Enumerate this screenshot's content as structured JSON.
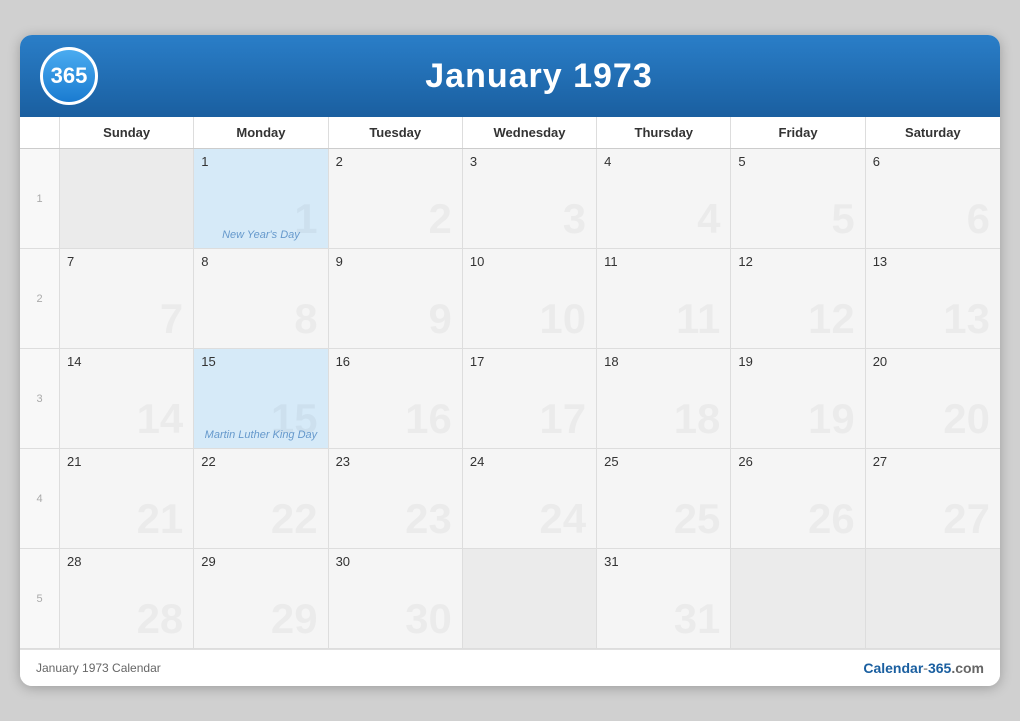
{
  "header": {
    "logo": "365",
    "title": "January 1973"
  },
  "days": [
    "Sunday",
    "Monday",
    "Tuesday",
    "Wednesday",
    "Thursday",
    "Friday",
    "Saturday"
  ],
  "weeks": [
    {
      "week_num": "1",
      "cells": [
        {
          "date": "",
          "empty": true
        },
        {
          "date": "1",
          "holiday": "New Year's Day",
          "highlight": true
        },
        {
          "date": "2"
        },
        {
          "date": "3"
        },
        {
          "date": "4"
        },
        {
          "date": "5"
        },
        {
          "date": "6"
        }
      ]
    },
    {
      "week_num": "2",
      "cells": [
        {
          "date": "7"
        },
        {
          "date": "8"
        },
        {
          "date": "9"
        },
        {
          "date": "10"
        },
        {
          "date": "11"
        },
        {
          "date": "12"
        },
        {
          "date": "13"
        }
      ]
    },
    {
      "week_num": "3",
      "cells": [
        {
          "date": "14"
        },
        {
          "date": "15",
          "holiday": "Martin Luther King Day",
          "highlight": true
        },
        {
          "date": "16"
        },
        {
          "date": "17"
        },
        {
          "date": "18"
        },
        {
          "date": "19"
        },
        {
          "date": "20"
        }
      ]
    },
    {
      "week_num": "4",
      "cells": [
        {
          "date": "21"
        },
        {
          "date": "22"
        },
        {
          "date": "23"
        },
        {
          "date": "24"
        },
        {
          "date": "25"
        },
        {
          "date": "26"
        },
        {
          "date": "27"
        }
      ]
    },
    {
      "week_num": "5",
      "cells": [
        {
          "date": "28"
        },
        {
          "date": "29"
        },
        {
          "date": "30"
        },
        {
          "date": ""
        },
        {
          "date": "31"
        },
        {
          "date": ""
        },
        {
          "date": ""
        },
        {
          "date": ""
        }
      ]
    }
  ],
  "footer": {
    "left": "January 1973 Calendar",
    "right": "Calendar-365.com"
  }
}
